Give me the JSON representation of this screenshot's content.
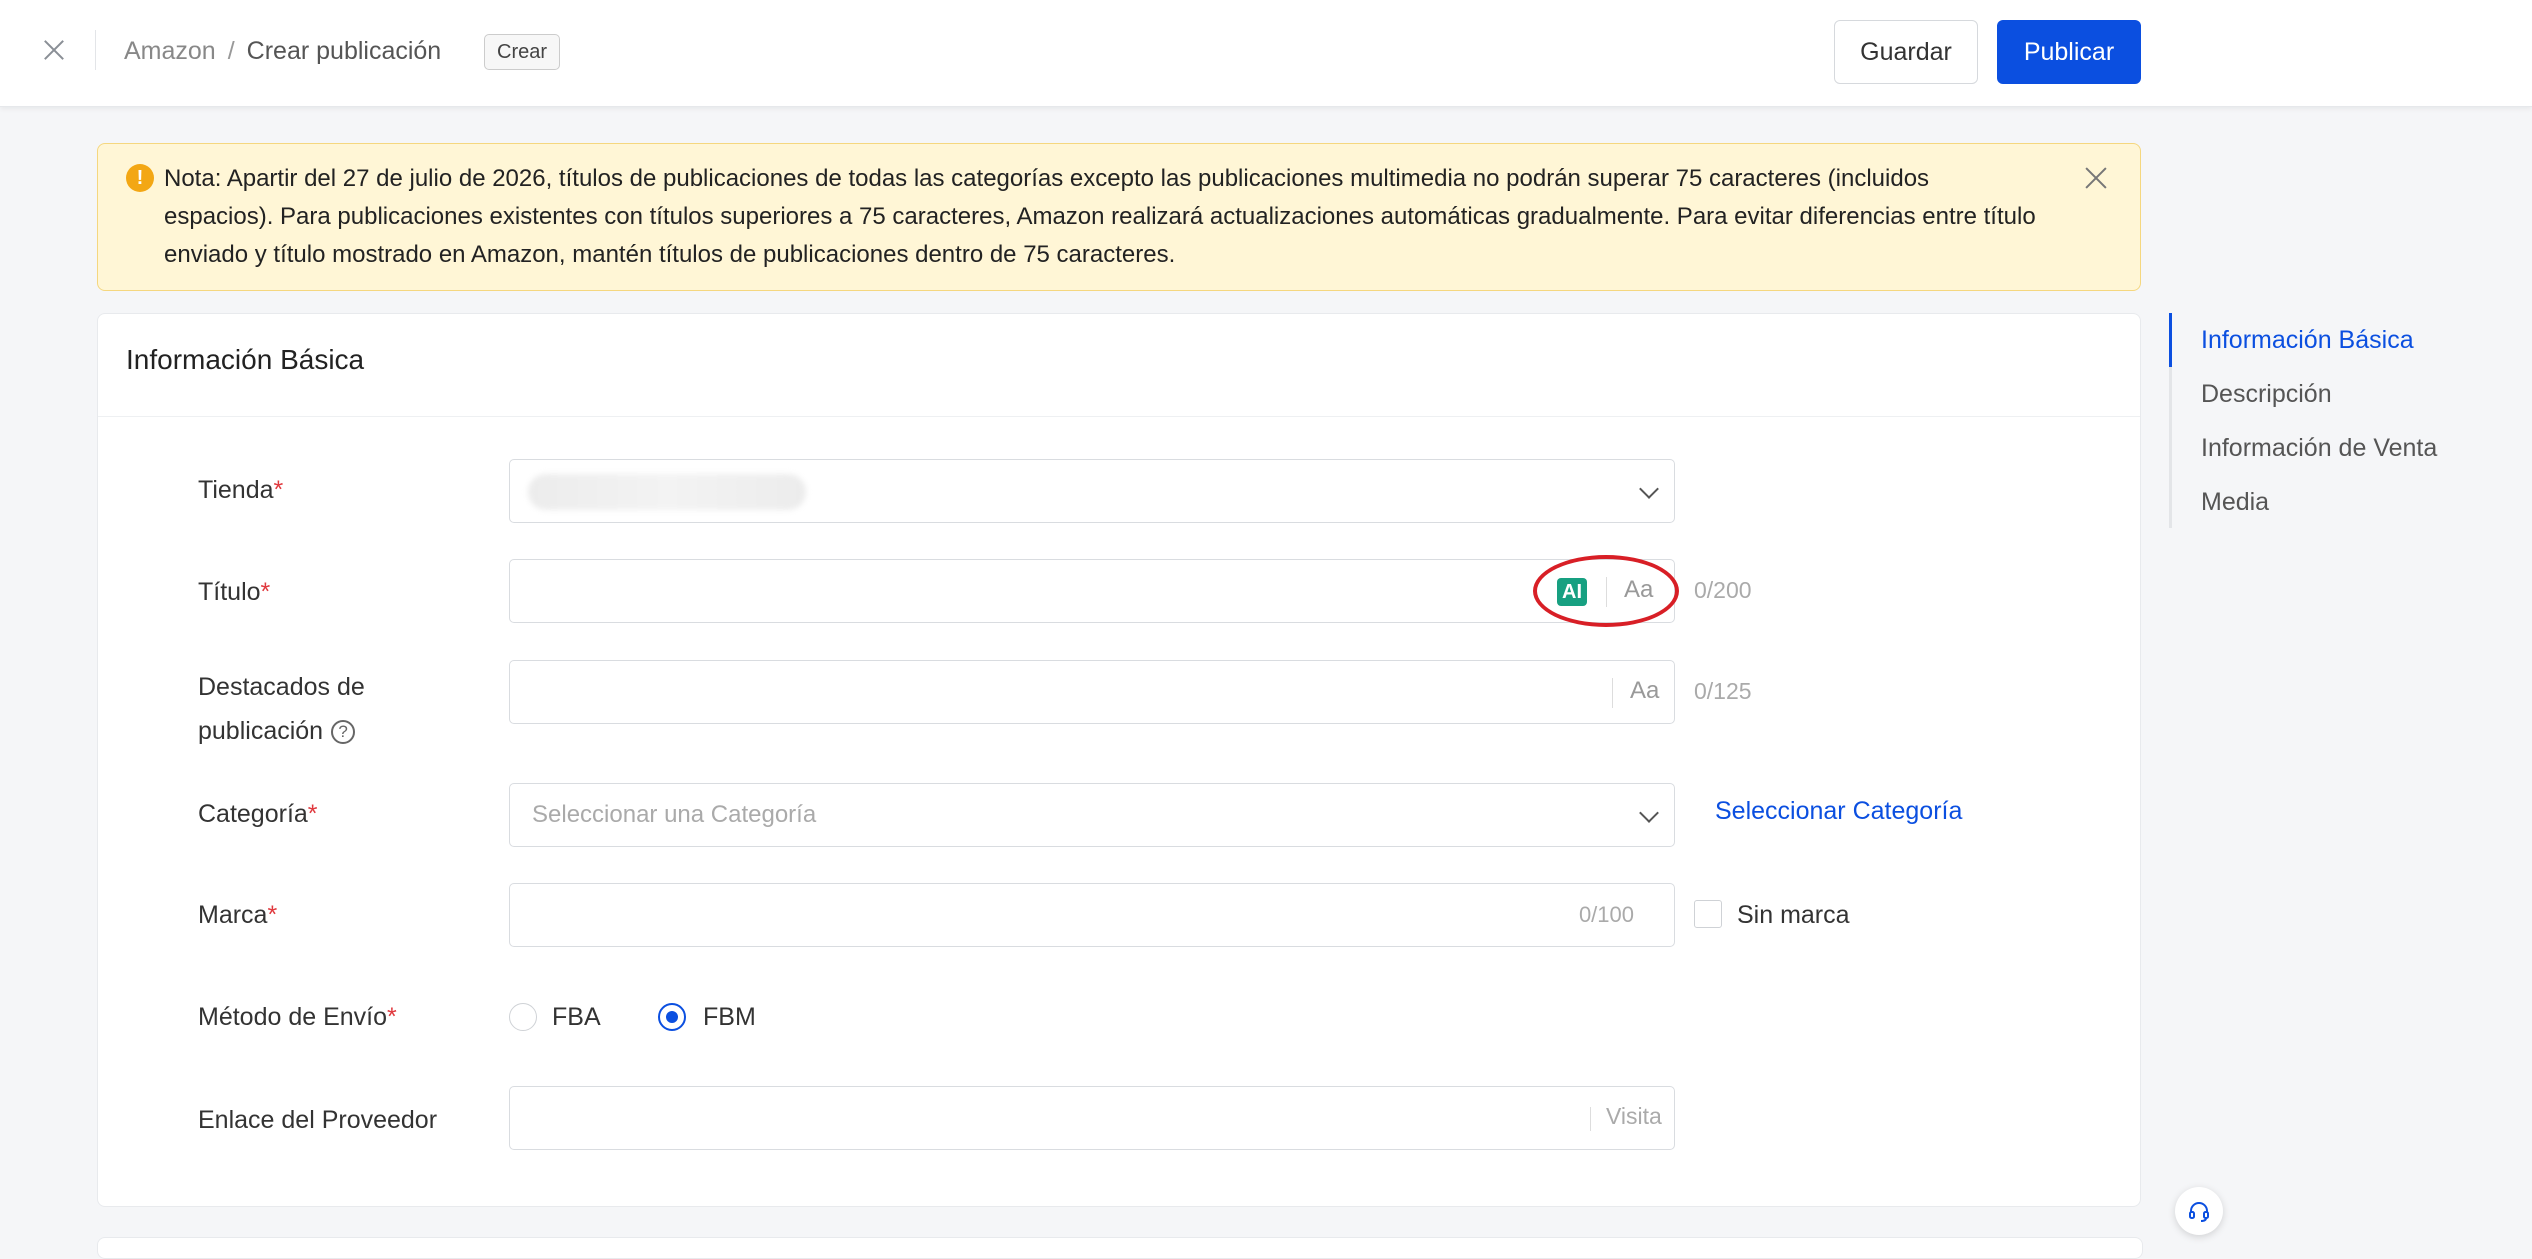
{
  "header": {
    "breadcrumb_root": "Amazon",
    "breadcrumb_sep": "/",
    "breadcrumb_current": "Crear publicación",
    "tag": "Crear",
    "save_label": "Guardar",
    "publish_label": "Publicar"
  },
  "notice": {
    "text": "Nota: Apartir del 27 de julio de 2026, títulos de publicaciones de todas las categorías excepto las publicaciones multimedia no podrán superar 75 caracteres (incluidos espacios). Para publicaciones existentes con títulos superiores a 75 caracteres, Amazon realizará actualizaciones automáticas gradualmente. Para evitar diferencias entre título enviado y título mostrado en Amazon, mantén títulos de publicaciones dentro de 75 caracteres.",
    "icon": "!"
  },
  "basic_info": {
    "title": "Información Básica",
    "store": {
      "label": "Tienda",
      "required": "*"
    },
    "title_field": {
      "label": "Título",
      "required": "*",
      "ai": "AI",
      "aa": "Aa",
      "counter": "0/200"
    },
    "highlights": {
      "label_line1": "Destacados de",
      "label_line2": "publicación",
      "help": "?",
      "aa": "Aa",
      "counter": "0/125"
    },
    "category": {
      "label": "Categoría",
      "required": "*",
      "placeholder": "Seleccionar una Categoría",
      "link": "Seleccionar Categoría"
    },
    "brand": {
      "label": "Marca",
      "required": "*",
      "counter": "0/100",
      "no_brand": "Sin marca"
    },
    "shipping": {
      "label": "Método de Envío",
      "required": "*",
      "options": [
        "FBA",
        "FBM"
      ],
      "selected": "FBM"
    },
    "supplier": {
      "label": "Enlace del Proveedor",
      "visit": "Visita"
    }
  },
  "anchors": [
    "Información Básica",
    "Descripción",
    "Información de Venta",
    "Media"
  ],
  "colors": {
    "primary": "#0b4fe0",
    "ai_badge": "#17a081",
    "highlight_oval": "#d81f26",
    "notice_bg": "#fff6d6"
  }
}
